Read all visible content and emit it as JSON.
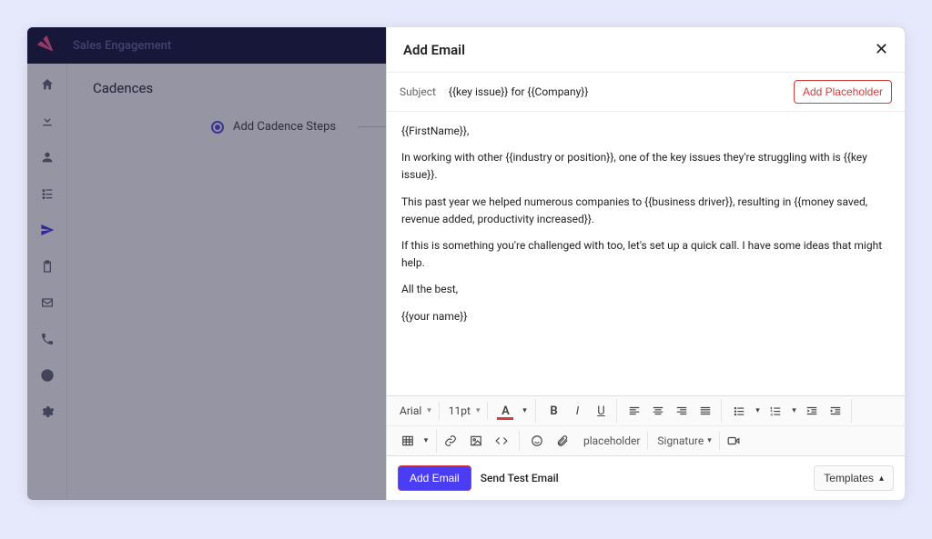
{
  "brand": "Sales Engagement",
  "page": {
    "title": "Cadences",
    "step_label": "Add Cadence Steps"
  },
  "sidebar": {
    "icons": [
      "home",
      "download",
      "person",
      "list",
      "send",
      "clipboard",
      "mail",
      "phone",
      "chart",
      "gear"
    ]
  },
  "panel": {
    "title": "Add Email",
    "subject_label": "Subject",
    "subject_value": "{{key issue}} for {{Company}}",
    "add_placeholder": "Add Placeholder",
    "body": {
      "p1": "{{FirstName}},",
      "p2": "In working with other {{industry or position}}, one of the key issues they're struggling with is {{key issue}}.",
      "p3": "This past year we helped numerous companies to {{business driver}}, resulting in {{money saved, revenue added, productivity increased}}.",
      "p4": "If this is something you're challenged with too, let's set up a quick call. I have some ideas that might help.",
      "p5": "All the best,",
      "p6": "{{your name}}"
    },
    "toolbar": {
      "font": "Arial",
      "size": "11pt",
      "placeholder_btn": "placeholder",
      "signature_btn": "Signature"
    },
    "footer": {
      "add_email": "Add Email",
      "send_test": "Send Test Email",
      "templates": "Templates"
    }
  }
}
